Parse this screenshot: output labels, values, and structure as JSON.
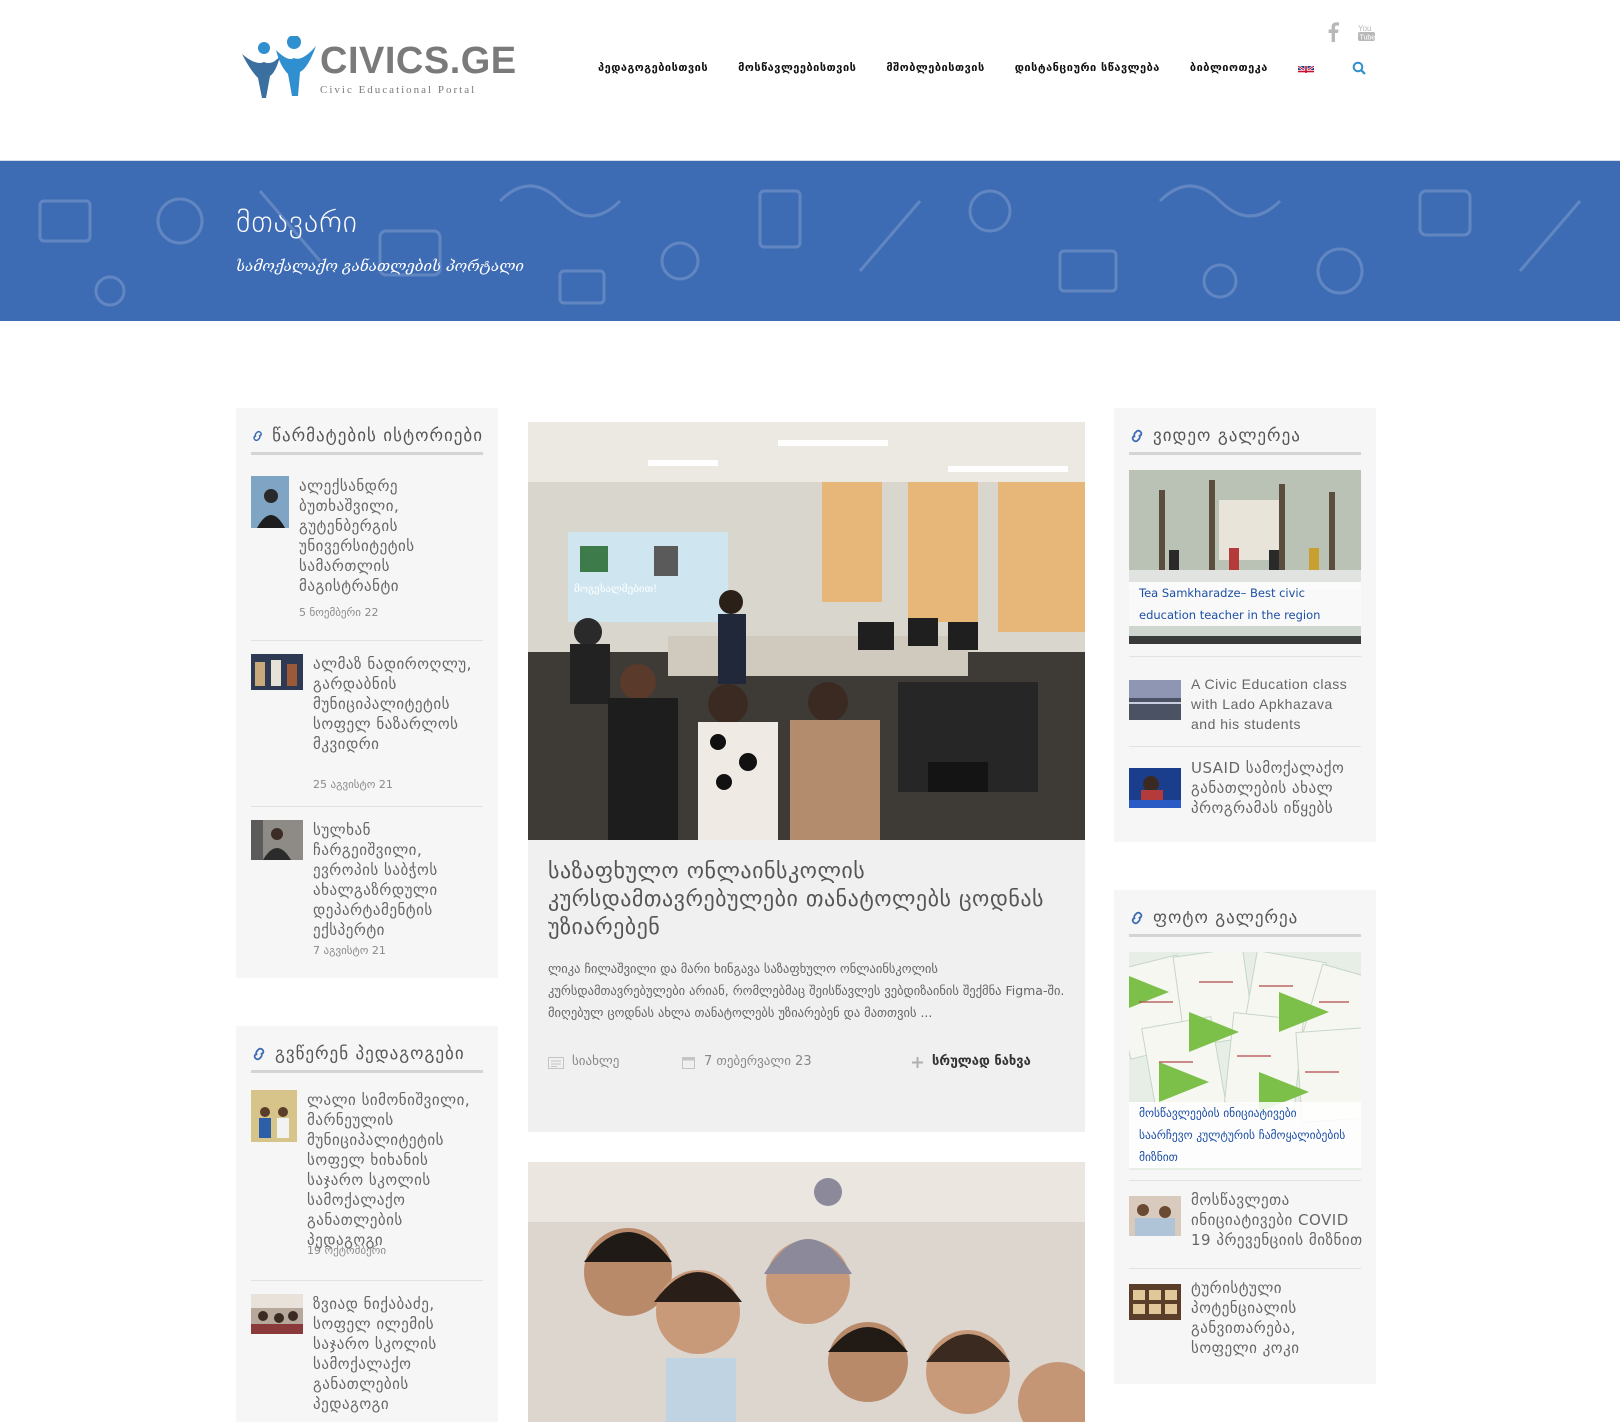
{
  "header": {
    "logo_title": "CIVICS.GE",
    "logo_subtitle": "Civic Educational Portal",
    "nav": [
      "პედაგოგებისთვის",
      "მოსწავლეებისთვის",
      "მშობლებისთვის",
      "დისტანციური სწავლება",
      "ბიბლიოთეკა"
    ],
    "social_icons": [
      "facebook-icon",
      "youtube-icon"
    ]
  },
  "banner": {
    "title": "მთავარი",
    "subtitle": "სამოქალაქო განათლების პორტალი"
  },
  "left": {
    "success": {
      "heading": "წარმატების ისტორიები",
      "items": [
        {
          "title": "ალექსანდრე ბუთხაშვილი, გუტენბერგის უნივერსიტეტის სამართლის მაგისტრანტი",
          "date": "5 ნოემბერი 22"
        },
        {
          "title": "ალმაზ ნადიროღლუ, გარდაბნის მუნიციპალიტეტის სოფელ ნაზარლოს მკვიდრი",
          "date": "25 აგვისტო 21"
        },
        {
          "title": "სულხან ჩარგეიშვილი, ევროპის საბჭოს ახალგაზრდული დეპარტამენტის ექსპერტი",
          "date": "7 აგვისტო 21"
        }
      ]
    },
    "teachers": {
      "heading": "გვწერენ პედაგოგები",
      "items": [
        {
          "title": "ლალი სიმონიშვილი, მარნეულის მუნიციპალიტეტის სოფელ ხიხანის საჯარო სკოლის სამოქალაქო განათლების პედაგოგი",
          "date": "19 ოქტომბერი"
        },
        {
          "title": "ზვიად ნიქაბაძე, სოფელ ილემის საჯარო სკოლის სამოქალაქო განათლების პედაგოგი",
          "date": ""
        }
      ]
    }
  },
  "article": {
    "title": "საზაფხულო ონლაინსკოლის კურსდამთავრებულები თანატოლებს ცოდნას უზიარებენ",
    "excerpt": "ლიკა ჩილაშვილი და მარი ხინგავა საზაფხულო ონლაინსკოლის კურსდამთავრებულები არიან, რომლებმაც შეისწავლეს ვებდიზაინის შექმნა Figma-ში. მიღებულ ცოდნას ახლა თანატოლებს უზიარებენ და მათთვის ...",
    "category": "სიახლე",
    "date": "7 თებერვალი 23",
    "read_more": "სრულად ნახვა",
    "slide_text": "მოგესალმებით!"
  },
  "right": {
    "video": {
      "heading": "ვიდეო გალერეა",
      "featured_caption": "Tea Samkharadze– Best civic education teacher in the region",
      "items": [
        {
          "title": "A Civic Education class with Lado Apkhazava and his students"
        },
        {
          "title": "USAID სამოქალაქო განათლების ახალ პროგრამას იწყებს"
        }
      ]
    },
    "photo": {
      "heading": "ფოტო გალერეა",
      "featured_caption": "მოსწავლეების ინიციატივები საარჩევო კულტურის ჩამოყალიბების მიზნით",
      "items": [
        {
          "title": "მოსწავლეთა ინიციატივები COVID 19 პრევენციის მიზნით"
        },
        {
          "title": "ტურისტული პოტენციალის განვითარება, სოფელი კოკი"
        }
      ]
    }
  },
  "colors": {
    "banner_blue": "#3e6cb4",
    "accent_blue": "#1d4fa6",
    "logo_blue": "#2f8fcf"
  }
}
